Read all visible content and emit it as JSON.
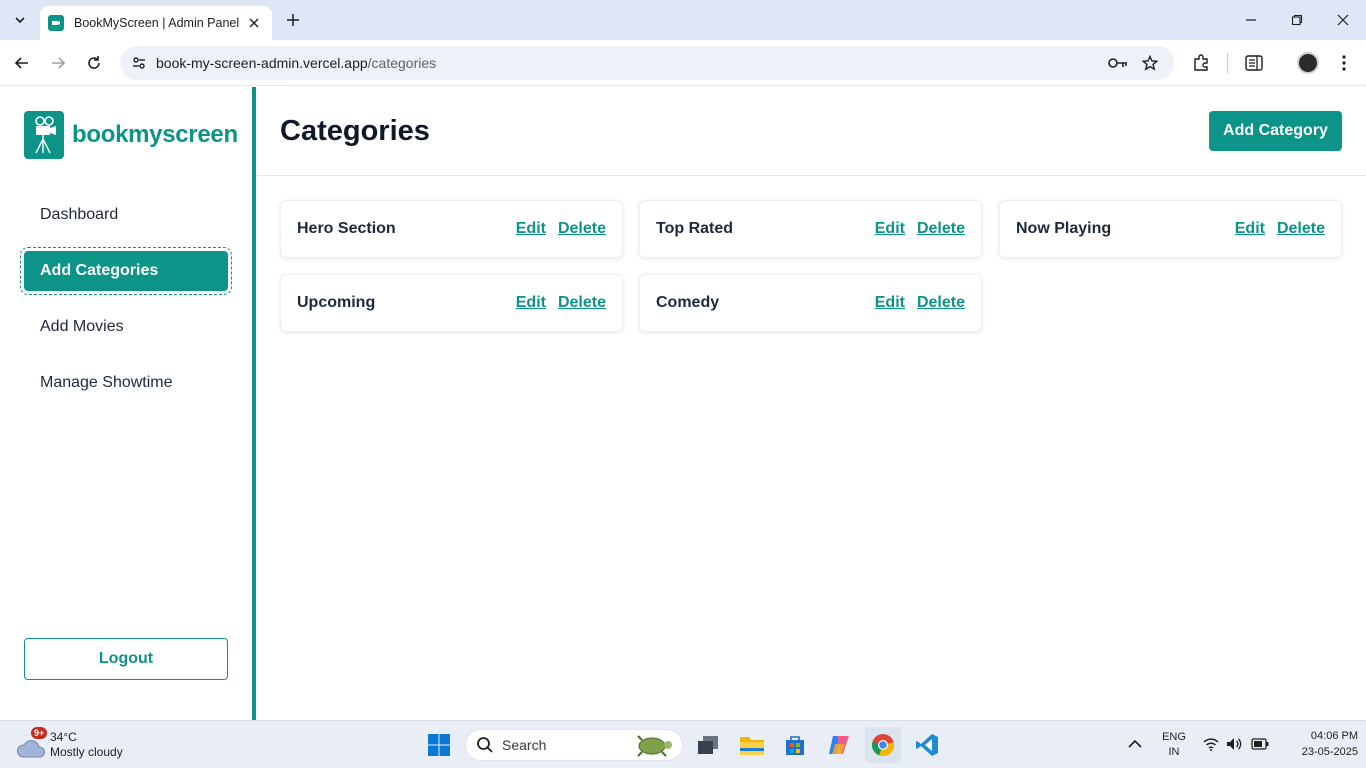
{
  "browser": {
    "tab_title": "BookMyScreen | Admin Panel",
    "url_host": "book-my-screen-admin.vercel.app",
    "url_path": "/categories"
  },
  "sidebar": {
    "brand": "bookmyscreen",
    "items": [
      {
        "label": "Dashboard"
      },
      {
        "label": "Add Categories"
      },
      {
        "label": "Add Movies"
      },
      {
        "label": "Manage Showtime"
      }
    ],
    "logout_label": "Logout"
  },
  "main": {
    "title": "Categories",
    "add_button": "Add Category",
    "edit_label": "Edit",
    "delete_label": "Delete",
    "categories": [
      {
        "name": "Hero Section"
      },
      {
        "name": "Top Rated"
      },
      {
        "name": "Now Playing"
      },
      {
        "name": "Upcoming"
      },
      {
        "name": "Comedy"
      }
    ]
  },
  "taskbar": {
    "weather_badge": "9+",
    "temperature": "34°C",
    "weather_desc": "Mostly cloudy",
    "search_label": "Search",
    "lang_line1": "ENG",
    "lang_line2": "IN",
    "time": "04:06 PM",
    "date": "23-05-2025"
  },
  "colors": {
    "accent": "#0d9488",
    "tabbar": "#dfe6f5",
    "taskbar": "#e9eef6"
  }
}
